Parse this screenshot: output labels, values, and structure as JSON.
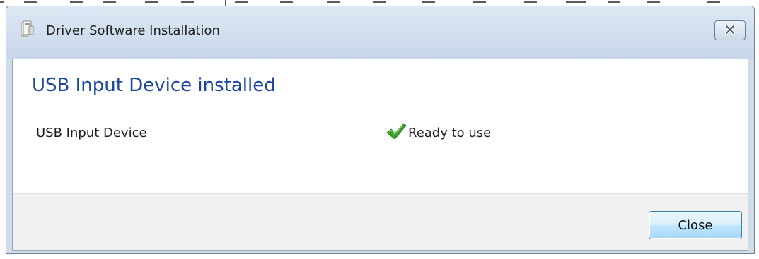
{
  "dialog": {
    "title": "Driver Software Installation",
    "heading": "USB Input Device installed",
    "device": {
      "name": "USB Input Device",
      "status": "Ready to use"
    },
    "close_button_label": "Close"
  },
  "icons": {
    "title": "driver-installer-icon",
    "status": "green-checkmark-icon",
    "window_close": "close-x-icon"
  },
  "colors": {
    "heading": "#1a45a0",
    "check": "#3e9f2a",
    "title_bar": "#cfdcea",
    "footer": "#f0f0f0"
  }
}
